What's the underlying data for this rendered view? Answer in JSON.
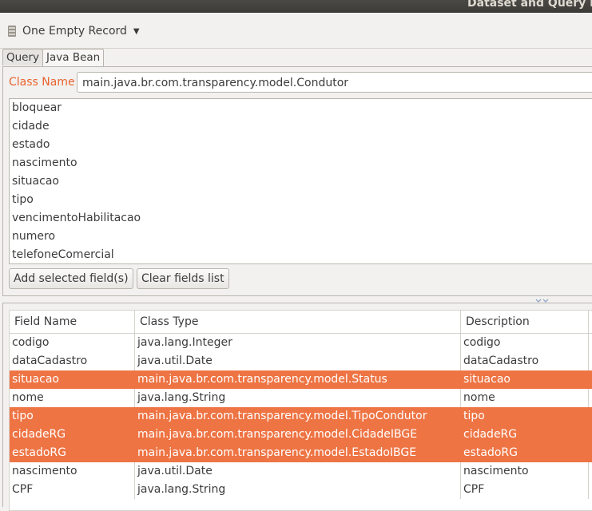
{
  "window": {
    "title": "Dataset and Query Dialog"
  },
  "toolbar": {
    "record_label": "One Empty Record"
  },
  "tabs": [
    {
      "label": "Query",
      "active": false
    },
    {
      "label": "Java Bean",
      "active": true
    }
  ],
  "bean": {
    "class_label": "Class Name",
    "class_value": "main.java.br.com.transparency.model.Condutor",
    "properties": [
      "bloquear",
      "cidade",
      "estado",
      "nascimento",
      "situacao",
      "tipo",
      "vencimentoHabilitacao",
      "numero",
      "telefoneComercial"
    ],
    "add_button": "Add selected field(s)",
    "clear_button": "Clear fields list"
  },
  "fields_table": {
    "columns": [
      "Field Name",
      "Class Type",
      "Description"
    ],
    "rows": [
      {
        "name": "codigo",
        "type": "java.lang.Integer",
        "description": "codigo",
        "selected": false
      },
      {
        "name": "dataCadastro",
        "type": "java.util.Date",
        "description": "dataCadastro",
        "selected": false
      },
      {
        "name": "situacao",
        "type": "main.java.br.com.transparency.model.Status",
        "description": "situacao",
        "selected": true
      },
      {
        "name": "nome",
        "type": "java.lang.String",
        "description": "nome",
        "selected": false
      },
      {
        "name": "tipo",
        "type": "main.java.br.com.transparency.model.TipoCondutor",
        "description": "tipo",
        "selected": true
      },
      {
        "name": "cidadeRG",
        "type": "main.java.br.com.transparency.model.CidadeIBGE",
        "description": "cidadeRG",
        "selected": true
      },
      {
        "name": "estadoRG",
        "type": "main.java.br.com.transparency.model.EstadoIBGE",
        "description": "estadoRG",
        "selected": true
      },
      {
        "name": "nascimento",
        "type": "java.util.Date",
        "description": "nascimento",
        "selected": false
      },
      {
        "name": "CPF",
        "type": "java.lang.String",
        "description": "CPF",
        "selected": false
      }
    ]
  },
  "colors": {
    "accent": "#e9632e",
    "selection": "#ee7444",
    "titlebar": "#3c3b37"
  },
  "icons": {
    "record": "database-icon",
    "dropdown": "caret-down-icon",
    "splitter": "splitter-handle-icon"
  }
}
